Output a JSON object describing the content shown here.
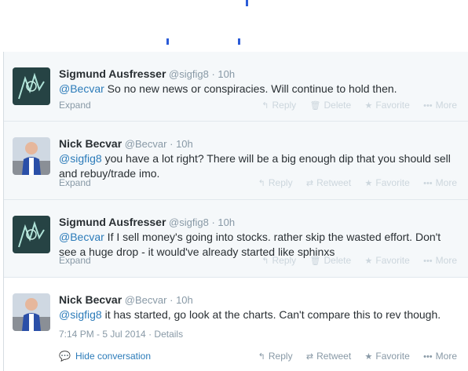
{
  "tweets": [
    {
      "fullname": "Sigmund Ausfresser",
      "username": "@sigfig8",
      "sep": "·",
      "time": "10h",
      "mention": "@Becvar",
      "text": " So no new news or conspiracies. Will continue to hold then.",
      "expand": "Expand",
      "actions": {
        "reply": "Reply",
        "delete": "Delete",
        "favorite": "Favorite",
        "more": "More"
      }
    },
    {
      "fullname": "Nick Becvar",
      "username": "@Becvar",
      "sep": "·",
      "time": "10h",
      "mention": "@sigfig8",
      "text": " you have a lot right? There will be a big enough dip that you should sell and rebuy/trade imo.",
      "expand": "Expand",
      "actions": {
        "reply": "Reply",
        "retweet": "Retweet",
        "favorite": "Favorite",
        "more": "More"
      }
    },
    {
      "fullname": "Sigmund Ausfresser",
      "username": "@sigfig8",
      "sep": "·",
      "time": "10h",
      "mention": "@Becvar",
      "text": " If I sell money's going into stocks. rather skip the wasted effort. Don't see a huge drop - it would've already started like sphinxs",
      "expand": "Expand",
      "actions": {
        "reply": "Reply",
        "delete": "Delete",
        "favorite": "Favorite",
        "more": "More"
      }
    },
    {
      "fullname": "Nick Becvar",
      "username": "@Becvar",
      "sep": "·",
      "time": "10h",
      "mention": "@sigfig8",
      "text": " it has started, go look at the charts. Can't compare this to rev though.",
      "timestamp": "7:14 PM - 5 Jul 2014",
      "details": "Details",
      "hide_conversation": "Hide conversation",
      "actions": {
        "reply": "Reply",
        "retweet": "Retweet",
        "favorite": "Favorite",
        "more": "More"
      }
    }
  ],
  "icons": {
    "reply": "↰",
    "delete": "🗑",
    "retweet": "⇄",
    "favorite": "★",
    "more": "•••",
    "conversation": "💬"
  },
  "colors": {
    "link": "#2b7bb9",
    "muted": "#8899a6",
    "faint": "#ccd6dd",
    "tick": "#2b5bd7"
  }
}
